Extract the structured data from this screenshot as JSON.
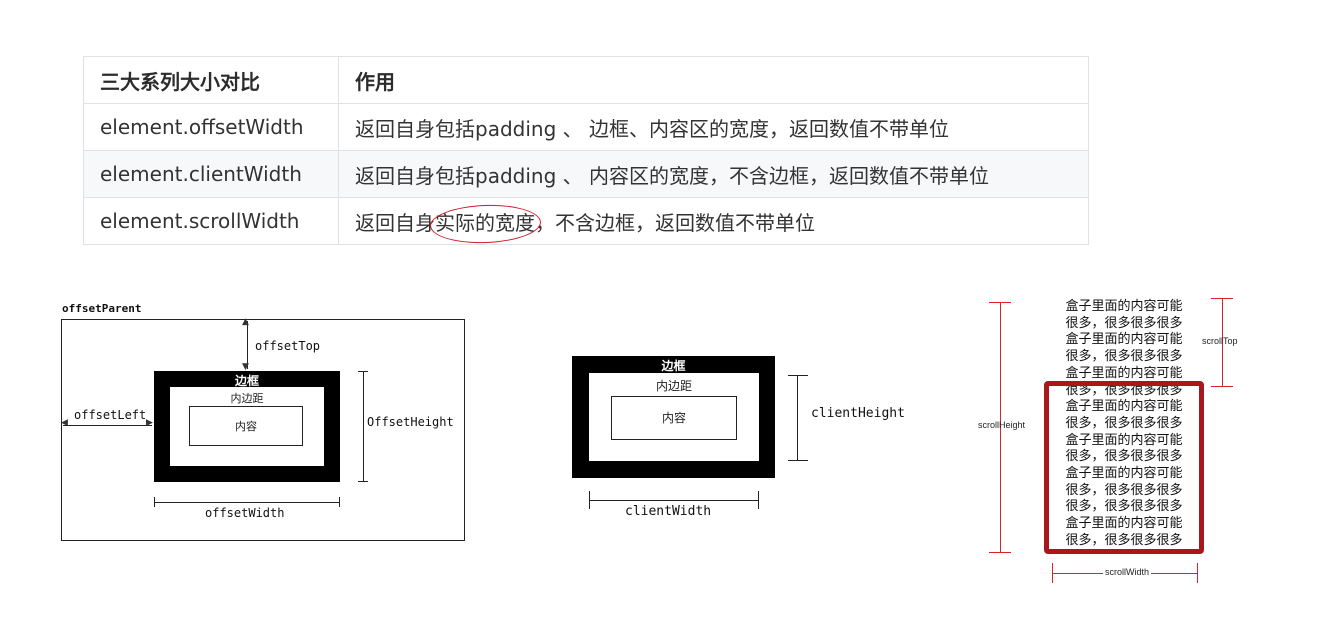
{
  "table": {
    "header": [
      "三大系列大小对比",
      "作用"
    ],
    "rows": [
      [
        "element.offsetWidth",
        "返回自身包括padding 、 边框、内容区的宽度，返回数值不带单位"
      ],
      [
        "element.clientWidth",
        "返回自身包括padding 、 内容区的宽度，不含边框，返回数值不带单位"
      ],
      {
        "prop": "element.scrollWidth",
        "before": "返回自身",
        "circled": "实际的宽度",
        "after": "，不含边框，返回数值不带单位"
      }
    ]
  },
  "offset_diagram": {
    "parent_label": "offsetParent",
    "border_label": "边框",
    "padding_label": "内边距",
    "content_label": "内容",
    "top_label": "offsetTop",
    "left_label": "offsetLeft",
    "height_label": "OffsetHeight",
    "width_label": "offsetWidth"
  },
  "client_diagram": {
    "border_label": "边框",
    "padding_label": "内边距",
    "content_label": "内容",
    "height_label": "clientHeight",
    "width_label": "clientWidth"
  },
  "scroll_diagram": {
    "lines": [
      "盒子里面的内容可能",
      "很多，很多很多很多",
      "盒子里面的内容可能",
      "很多，很多很多很多",
      "盒子里面的内容可能",
      "很多，很多很多很多",
      "盒子里面的内容可能",
      "很多，很多很多很多",
      "盒子里面的内容可能",
      "很多，很多很多很多",
      "盒子里面的内容可能",
      "很多，很多很多很多",
      "很多，很多很多很多",
      "盒子里面的内容可能",
      "很多，很多很多很多"
    ],
    "height_label": "scrollHeight",
    "top_label": "scrollTop",
    "width_label": "scrollWidth",
    "accent_color": "#a8171b",
    "guide_color": "#d9232a"
  }
}
